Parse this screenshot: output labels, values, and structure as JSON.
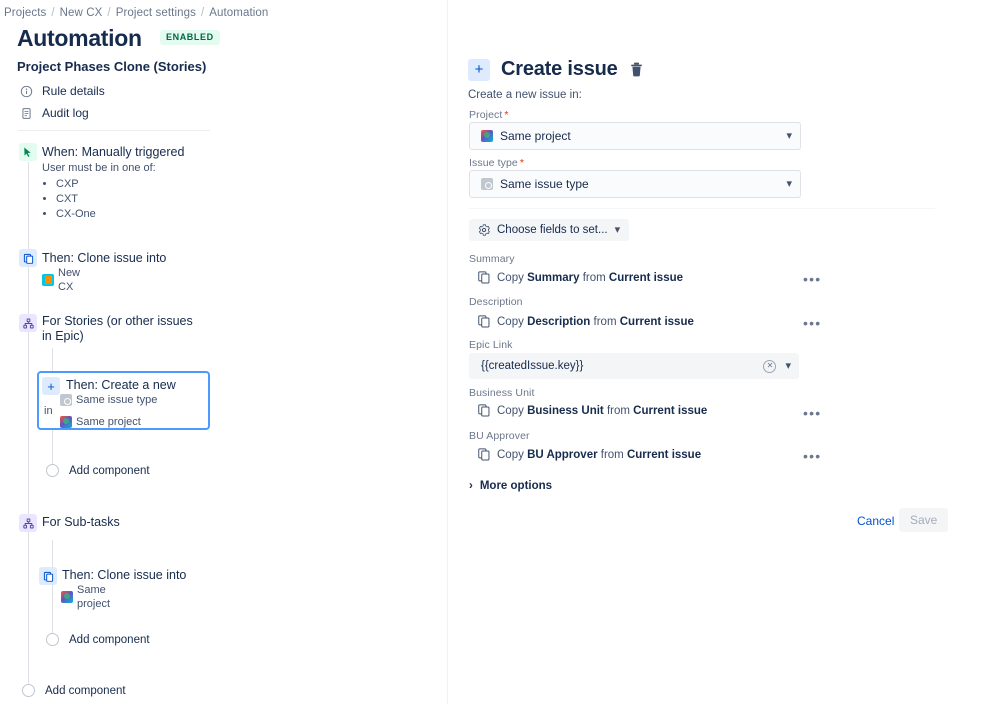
{
  "breadcrumb": {
    "items": [
      "Projects",
      "New CX",
      "Project settings",
      "Automation"
    ],
    "separator": "/"
  },
  "header": {
    "title": "Automation",
    "status_badge": "ENABLED",
    "badge_color": "#006644",
    "badge_bg": "#e3fcef"
  },
  "rule": {
    "name": "Project Phases Clone (Stories)",
    "nav": [
      {
        "label": "Rule details",
        "icon": "info-icon"
      },
      {
        "label": "Audit log",
        "icon": "document-icon"
      }
    ]
  },
  "tree": {
    "trigger": {
      "title": "When: Manually triggered",
      "sub_label": "User must be in one of:",
      "roles": [
        "CXP",
        "CXT",
        "CX-One"
      ]
    },
    "clone_action": {
      "title": "Then: Clone issue into",
      "target": "New CX"
    },
    "branch_stories": {
      "title": "For Stories (or other issues in Epic)",
      "child": {
        "title": "Then: Create a new",
        "issue_type": "Same issue type",
        "joiner": "in",
        "project": "Same project",
        "selected": true
      },
      "add_component": "Add component"
    },
    "branch_subtasks": {
      "title": "For Sub-tasks",
      "child": {
        "title": "Then: Clone issue into",
        "project": "Same project"
      },
      "add_component": "Add component"
    },
    "add_component_root": "Add component"
  },
  "panel": {
    "title": "Create issue",
    "subtitle": "Create a new issue in:",
    "plus_icon": "plus-icon",
    "trash_icon": "trash-icon",
    "project_field": {
      "label": "Project",
      "required": "*",
      "value": "Same project"
    },
    "issue_type_field": {
      "label": "Issue type",
      "required": "*",
      "value": "Same issue type"
    },
    "choose_fields": {
      "label": "Choose fields to set...",
      "icon": "gear-icon"
    },
    "fields": [
      {
        "label": "Summary",
        "action_prefix": "Copy",
        "field_name": "Summary",
        "action_mid": "from",
        "source": "Current issue",
        "menu": "•••"
      },
      {
        "label": "Description",
        "action_prefix": "Copy",
        "field_name": "Description",
        "action_mid": "from",
        "source": "Current issue",
        "menu": "•••"
      },
      {
        "label": "Business Unit",
        "action_prefix": "Copy",
        "field_name": "Business Unit",
        "action_mid": "from",
        "source": "Current issue",
        "menu": "•••"
      },
      {
        "label": "BU Approver",
        "action_prefix": "Copy",
        "field_name": "BU Approver",
        "action_mid": "from",
        "source": "Current issue",
        "menu": "•••"
      }
    ],
    "epic_link": {
      "label": "Epic Link",
      "value": "{{createdIssue.key}}"
    },
    "more_options": {
      "label": "More options",
      "expanded": false
    },
    "buttons": {
      "cancel": "Cancel",
      "save": "Save",
      "save_disabled": true
    }
  }
}
